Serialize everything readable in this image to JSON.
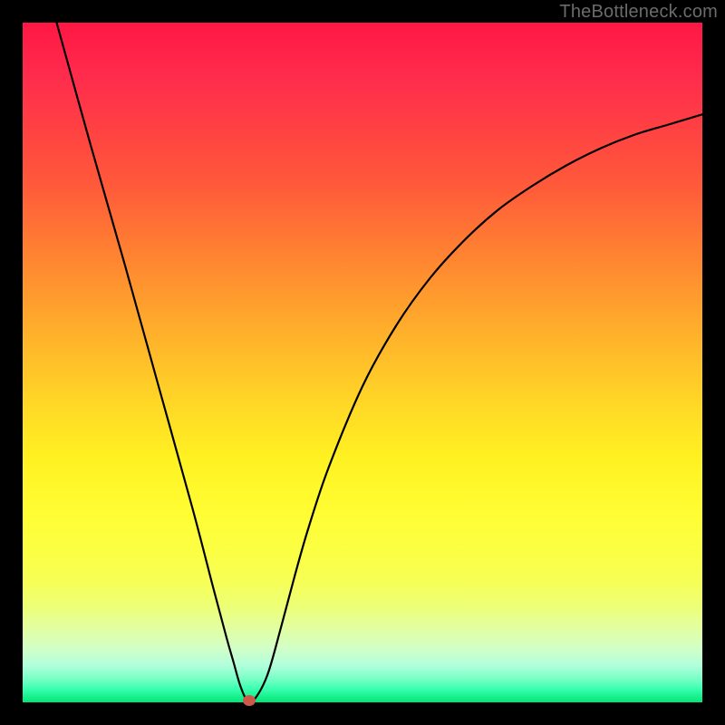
{
  "watermark": "TheBottleneck.com",
  "chart_data": {
    "type": "line",
    "title": "",
    "xlabel": "",
    "ylabel": "",
    "xlim": [
      0,
      100
    ],
    "ylim": [
      0,
      100
    ],
    "grid": false,
    "series": [
      {
        "name": "curve",
        "x": [
          5,
          10,
          15,
          20,
          25,
          28,
          30,
          31,
          32,
          33,
          34,
          36,
          38,
          40,
          42,
          45,
          50,
          55,
          60,
          65,
          70,
          75,
          80,
          85,
          90,
          95,
          100
        ],
        "y": [
          100,
          82,
          64.5,
          46.5,
          28.5,
          17,
          9.5,
          6,
          2.5,
          0.3,
          0.3,
          4,
          11,
          18.5,
          25.5,
          34.5,
          46.5,
          55.5,
          62.5,
          68,
          72.5,
          76,
          79,
          81.5,
          83.5,
          85,
          86.5
        ]
      }
    ],
    "marker": {
      "x": 33.3,
      "y": 0.3
    },
    "gradient_colors_top_to_bottom": [
      "#ff1744",
      "#ffb300",
      "#ffee00",
      "#00e676"
    ]
  }
}
